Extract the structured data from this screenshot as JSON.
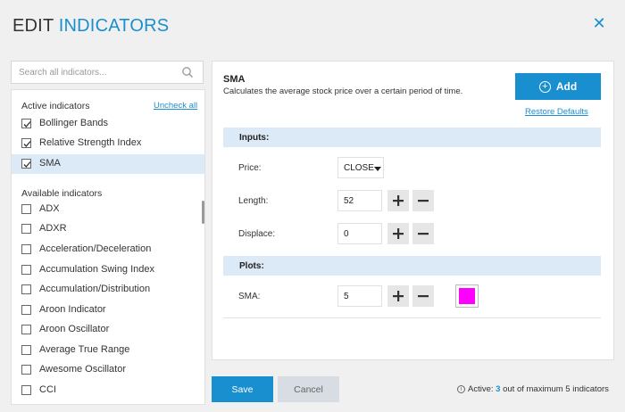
{
  "header": {
    "title_part1": "EDIT",
    "title_part2": "INDICATORS"
  },
  "search": {
    "placeholder": "Search all indicators..."
  },
  "active_section": {
    "heading": "Active indicators",
    "uncheck_all": "Uncheck all",
    "items": [
      {
        "label": "Bollinger Bands",
        "checked": true
      },
      {
        "label": "Relative Strength Index",
        "checked": true
      },
      {
        "label": "SMA",
        "checked": true,
        "selected": true
      }
    ]
  },
  "available_section": {
    "heading": "Available indicators",
    "items": [
      {
        "label": "ADX"
      },
      {
        "label": "ADXR"
      },
      {
        "label": "Acceleration/Deceleration"
      },
      {
        "label": "Accumulation Swing Index"
      },
      {
        "label": "Accumulation/Distribution"
      },
      {
        "label": "Aroon Indicator"
      },
      {
        "label": "Aroon Oscillator"
      },
      {
        "label": "Average True Range"
      },
      {
        "label": "Awesome Oscillator"
      },
      {
        "label": "CCI"
      }
    ]
  },
  "detail": {
    "name": "SMA",
    "description": "Calculates the average stock price over a certain period of time.",
    "add_label": "Add",
    "restore_defaults": "Restore Defaults",
    "inputs_heading": "Inputs:",
    "price_label": "Price:",
    "price_value": "CLOSE",
    "length_label": "Length:",
    "length_value": "52",
    "displace_label": "Displace:",
    "displace_value": "0",
    "plots_heading": "Plots:",
    "sma_label": "SMA:",
    "sma_value": "5",
    "sma_color": "#ff00ff"
  },
  "footer": {
    "save_label": "Save",
    "cancel_label": "Cancel",
    "info_prefix": "Active:",
    "active_count": "3",
    "info_suffix": "out of maximum 5 indicators"
  },
  "colors": {
    "accent": "#1a8fcf",
    "selected_row": "#dce9f7",
    "header_bg": "#f0f0f0"
  }
}
